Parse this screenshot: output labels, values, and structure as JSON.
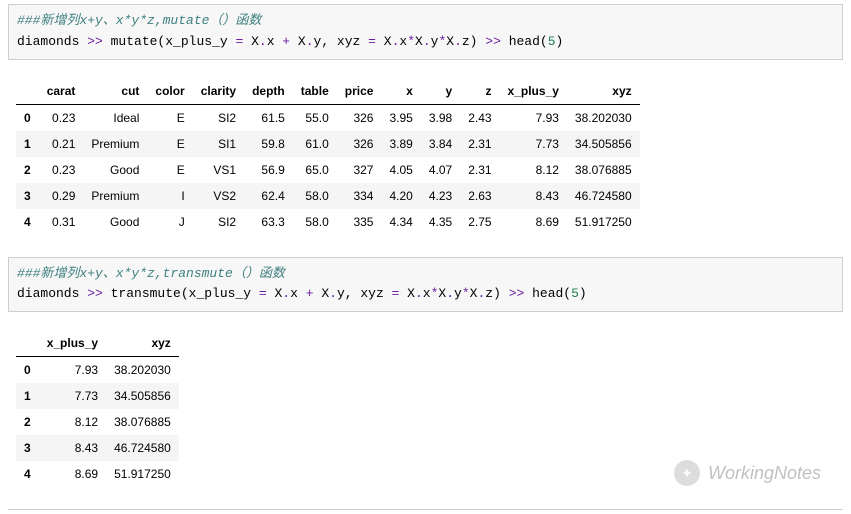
{
  "cell1": {
    "comment": "###新增列x+y、x*y*z,mutate（）函数",
    "code_parts": [
      {
        "t": "plain",
        "v": "diamonds "
      },
      {
        "t": "op",
        "v": ">>"
      },
      {
        "t": "plain",
        "v": " mutate(x_plus_y "
      },
      {
        "t": "op",
        "v": "="
      },
      {
        "t": "plain",
        "v": " X"
      },
      {
        "t": "op",
        "v": "."
      },
      {
        "t": "plain",
        "v": "x "
      },
      {
        "t": "op",
        "v": "+"
      },
      {
        "t": "plain",
        "v": " X"
      },
      {
        "t": "op",
        "v": "."
      },
      {
        "t": "plain",
        "v": "y, xyz "
      },
      {
        "t": "op",
        "v": "="
      },
      {
        "t": "plain",
        "v": " X"
      },
      {
        "t": "op",
        "v": "."
      },
      {
        "t": "plain",
        "v": "x"
      },
      {
        "t": "op",
        "v": "*"
      },
      {
        "t": "plain",
        "v": "X"
      },
      {
        "t": "op",
        "v": "."
      },
      {
        "t": "plain",
        "v": "y"
      },
      {
        "t": "op",
        "v": "*"
      },
      {
        "t": "plain",
        "v": "X"
      },
      {
        "t": "op",
        "v": "."
      },
      {
        "t": "plain",
        "v": "z) "
      },
      {
        "t": "op",
        "v": ">>"
      },
      {
        "t": "plain",
        "v": " head("
      },
      {
        "t": "num",
        "v": "5"
      },
      {
        "t": "plain",
        "v": ")"
      }
    ]
  },
  "table1": {
    "columns": [
      "carat",
      "cut",
      "color",
      "clarity",
      "depth",
      "table",
      "price",
      "x",
      "y",
      "z",
      "x_plus_y",
      "xyz"
    ],
    "rows": [
      {
        "idx": "0",
        "cells": [
          "0.23",
          "Ideal",
          "E",
          "SI2",
          "61.5",
          "55.0",
          "326",
          "3.95",
          "3.98",
          "2.43",
          "7.93",
          "38.202030"
        ]
      },
      {
        "idx": "1",
        "cells": [
          "0.21",
          "Premium",
          "E",
          "SI1",
          "59.8",
          "61.0",
          "326",
          "3.89",
          "3.84",
          "2.31",
          "7.73",
          "34.505856"
        ]
      },
      {
        "idx": "2",
        "cells": [
          "0.23",
          "Good",
          "E",
          "VS1",
          "56.9",
          "65.0",
          "327",
          "4.05",
          "4.07",
          "2.31",
          "8.12",
          "38.076885"
        ]
      },
      {
        "idx": "3",
        "cells": [
          "0.29",
          "Premium",
          "I",
          "VS2",
          "62.4",
          "58.0",
          "334",
          "4.20",
          "4.23",
          "2.63",
          "8.43",
          "46.724580"
        ]
      },
      {
        "idx": "4",
        "cells": [
          "0.31",
          "Good",
          "J",
          "SI2",
          "63.3",
          "58.0",
          "335",
          "4.34",
          "4.35",
          "2.75",
          "8.69",
          "51.917250"
        ]
      }
    ]
  },
  "cell2": {
    "comment": "###新增列x+y、x*y*z,transmute（）函数",
    "code_parts": [
      {
        "t": "plain",
        "v": "diamonds "
      },
      {
        "t": "op",
        "v": ">>"
      },
      {
        "t": "plain",
        "v": " transmute(x_plus_y "
      },
      {
        "t": "op",
        "v": "="
      },
      {
        "t": "plain",
        "v": " X"
      },
      {
        "t": "op",
        "v": "."
      },
      {
        "t": "plain",
        "v": "x "
      },
      {
        "t": "op",
        "v": "+"
      },
      {
        "t": "plain",
        "v": " X"
      },
      {
        "t": "op",
        "v": "."
      },
      {
        "t": "plain",
        "v": "y, xyz "
      },
      {
        "t": "op",
        "v": "="
      },
      {
        "t": "plain",
        "v": " X"
      },
      {
        "t": "op",
        "v": "."
      },
      {
        "t": "plain",
        "v": "x"
      },
      {
        "t": "op",
        "v": "*"
      },
      {
        "t": "plain",
        "v": "X"
      },
      {
        "t": "op",
        "v": "."
      },
      {
        "t": "plain",
        "v": "y"
      },
      {
        "t": "op",
        "v": "*"
      },
      {
        "t": "plain",
        "v": "X"
      },
      {
        "t": "op",
        "v": "."
      },
      {
        "t": "plain",
        "v": "z) "
      },
      {
        "t": "op",
        "v": ">>"
      },
      {
        "t": "plain",
        "v": " head("
      },
      {
        "t": "num",
        "v": "5"
      },
      {
        "t": "plain",
        "v": ")"
      }
    ]
  },
  "table2": {
    "columns": [
      "x_plus_y",
      "xyz"
    ],
    "rows": [
      {
        "idx": "0",
        "cells": [
          "7.93",
          "38.202030"
        ]
      },
      {
        "idx": "1",
        "cells": [
          "7.73",
          "34.505856"
        ]
      },
      {
        "idx": "2",
        "cells": [
          "8.12",
          "38.076885"
        ]
      },
      {
        "idx": "3",
        "cells": [
          "8.43",
          "46.724580"
        ]
      },
      {
        "idx": "4",
        "cells": [
          "8.69",
          "51.917250"
        ]
      }
    ]
  },
  "watermark": {
    "text": "WorkingNotes",
    "icon": "✦"
  }
}
